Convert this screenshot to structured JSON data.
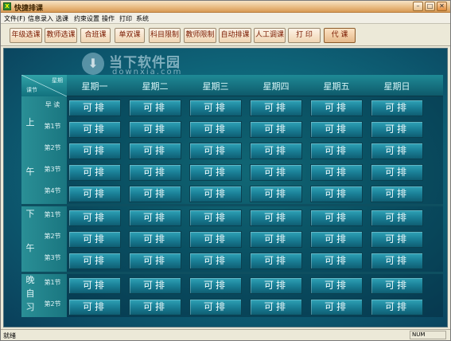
{
  "window": {
    "title": "快捷排课",
    "icon_glyph": "X"
  },
  "menu": [
    "文件(F)",
    "信息录入",
    "选课",
    "约束设置",
    "操作",
    "打印",
    "系统"
  ],
  "toolbar": [
    "年级选课",
    "教师选课",
    "合班课",
    "单双课",
    "科目限制",
    "教师限制",
    "自动排课",
    "人工调课",
    "打 印",
    "代 课"
  ],
  "watermark": {
    "text": "当下软件园",
    "url": "downxia.com"
  },
  "grid": {
    "corner_top": "星期",
    "corner_bottom": "课节",
    "days": [
      "星期一",
      "星期二",
      "星期三",
      "星期四",
      "星期五",
      "星期日"
    ],
    "groups": [
      "上",
      "午",
      "下",
      "午",
      "晚",
      "自",
      "习"
    ],
    "periods": [
      "早 读",
      "第1节",
      "第2节",
      "第3节",
      "第4节",
      "第1节",
      "第2节",
      "第3节",
      "第1节",
      "第2节"
    ],
    "cell_value": "可排"
  },
  "status": {
    "left": "就绪",
    "num": "NUM"
  }
}
